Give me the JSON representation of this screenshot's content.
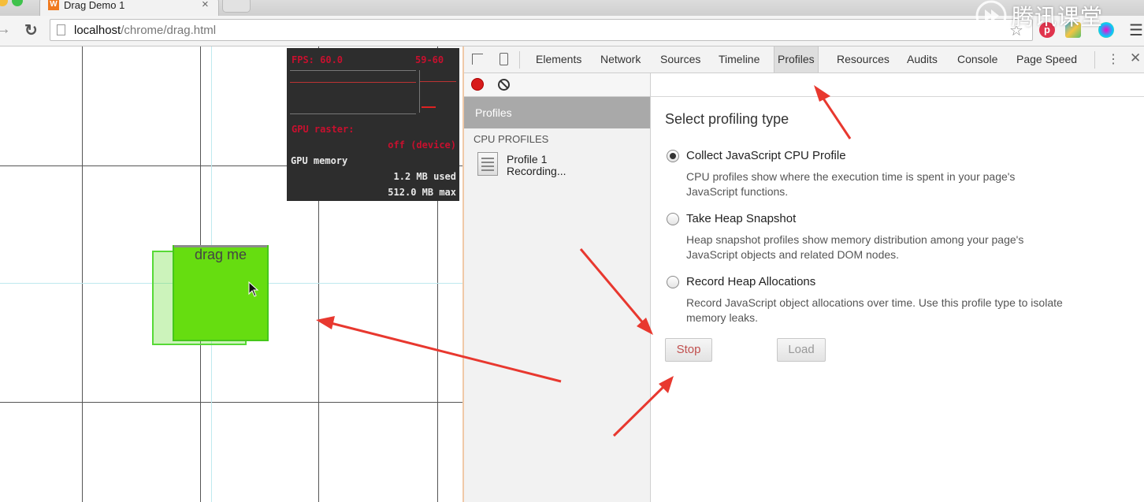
{
  "browser": {
    "tab_title": "Drag Demo 1",
    "tab_favicon": "W",
    "tab_close": "×",
    "url_host": "localhost",
    "url_path": "/chrome/drag.html",
    "pocket_letter": "p",
    "watermark": "腾讯课堂"
  },
  "page": {
    "drag_label": "drag me"
  },
  "hud": {
    "fps": "FPS: 60.0",
    "fps_range": "59-60",
    "gpu_raster": "GPU raster:",
    "gpu_raster_value": "off (device)",
    "gpu_memory": "GPU memory",
    "used": "1.2 MB used",
    "max": "512.0 MB max"
  },
  "devtools": {
    "tabs": [
      "Elements",
      "Network",
      "Sources",
      "Timeline",
      "Profiles",
      "Resources",
      "Audits",
      "Console",
      "Page Speed"
    ],
    "active_tab": "Profiles",
    "sidebar_header": "Profiles",
    "section_label": "CPU PROFILES",
    "profile_name": "Profile 1",
    "profile_status": "Recording...",
    "select_title": "Select profiling type",
    "options": [
      {
        "label": "Collect JavaScript CPU Profile",
        "desc1": "CPU profiles show where the execution time is spent in your page's",
        "desc2": "JavaScript functions.",
        "checked": true
      },
      {
        "label": "Take Heap Snapshot",
        "desc1": "Heap snapshot profiles show memory distribution among your page's",
        "desc2": "JavaScript objects and related DOM nodes.",
        "checked": false
      },
      {
        "label": "Record Heap Allocations",
        "desc1": "Record JavaScript object allocations over time. Use this profile type to isolate",
        "desc2": "memory leaks.",
        "checked": false
      }
    ],
    "stop_label": "Stop",
    "load_label": "Load"
  },
  "colors": {
    "annotation_arrow": "#e8382f",
    "drag_box": "#66dd10",
    "record": "#d81b1b"
  }
}
